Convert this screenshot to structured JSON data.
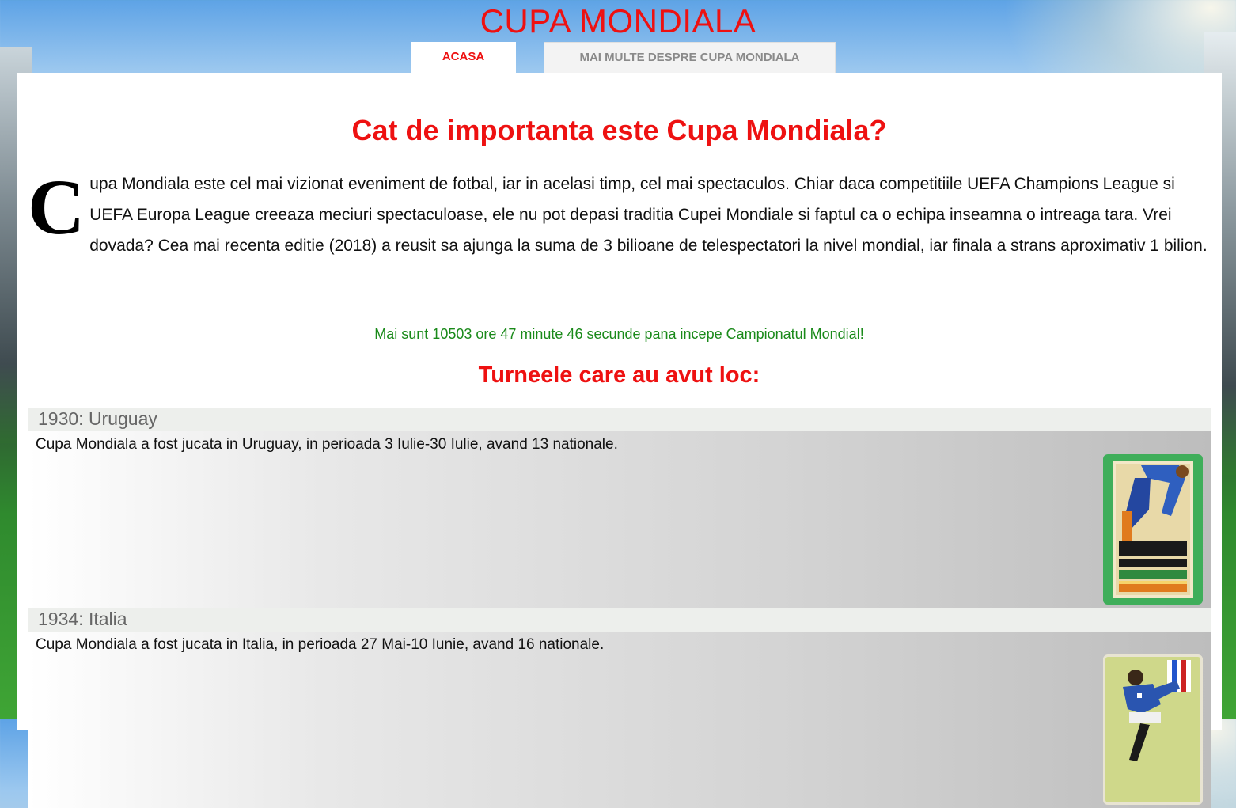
{
  "header": {
    "site_title": "CUPA MONDIALA",
    "tabs": [
      {
        "label": "ACASA",
        "active": true
      },
      {
        "label": "MAI MULTE DESPRE CUPA MONDIALA",
        "active": false
      }
    ]
  },
  "main": {
    "headline": "Cat de importanta este Cupa Mondiala?",
    "intro_dropcap": "C",
    "intro_text": "upa Mondiala este cel mai vizionat eveniment de fotbal, iar in acelasi timp, cel mai spectaculos. Chiar daca competitiile UEFA Champions League si UEFA Europa League creeaza meciuri spectaculoase, ele nu pot depasi traditia Cupei Mondiale si faptul ca o echipa inseamna o intreaga tara. Vrei dovada? Cea mai recenta editie (2018) a reusit sa ajunga la suma de 3 bilioane de telespectatori la nivel mondial, iar finala a strans aproximativ 1 bilion.",
    "countdown": "Mai sunt 10503 ore 47 minute 46 secunde pana incepe Campionatul Mondial!",
    "tournaments_heading": "Turneele care au avut loc:",
    "tournaments": [
      {
        "title": "1930: Uruguay",
        "description": "Cupa Mondiala a fost jucata in Uruguay, in perioada 3 Iulie-30 Iulie, avand 13 nationale.",
        "poster_icon": "world-cup-1930-poster"
      },
      {
        "title": "1934: Italia",
        "description": "Cupa Mondiala a fost jucata in Italia, in perioada 27 Mai-10 Iunie, avand 16 nationale.",
        "poster_icon": "world-cup-1934-poster"
      }
    ]
  },
  "colors": {
    "accent_red": "#ee1111",
    "countdown_green": "#1a8a1a",
    "tournament_header_bg": "#edefec"
  }
}
